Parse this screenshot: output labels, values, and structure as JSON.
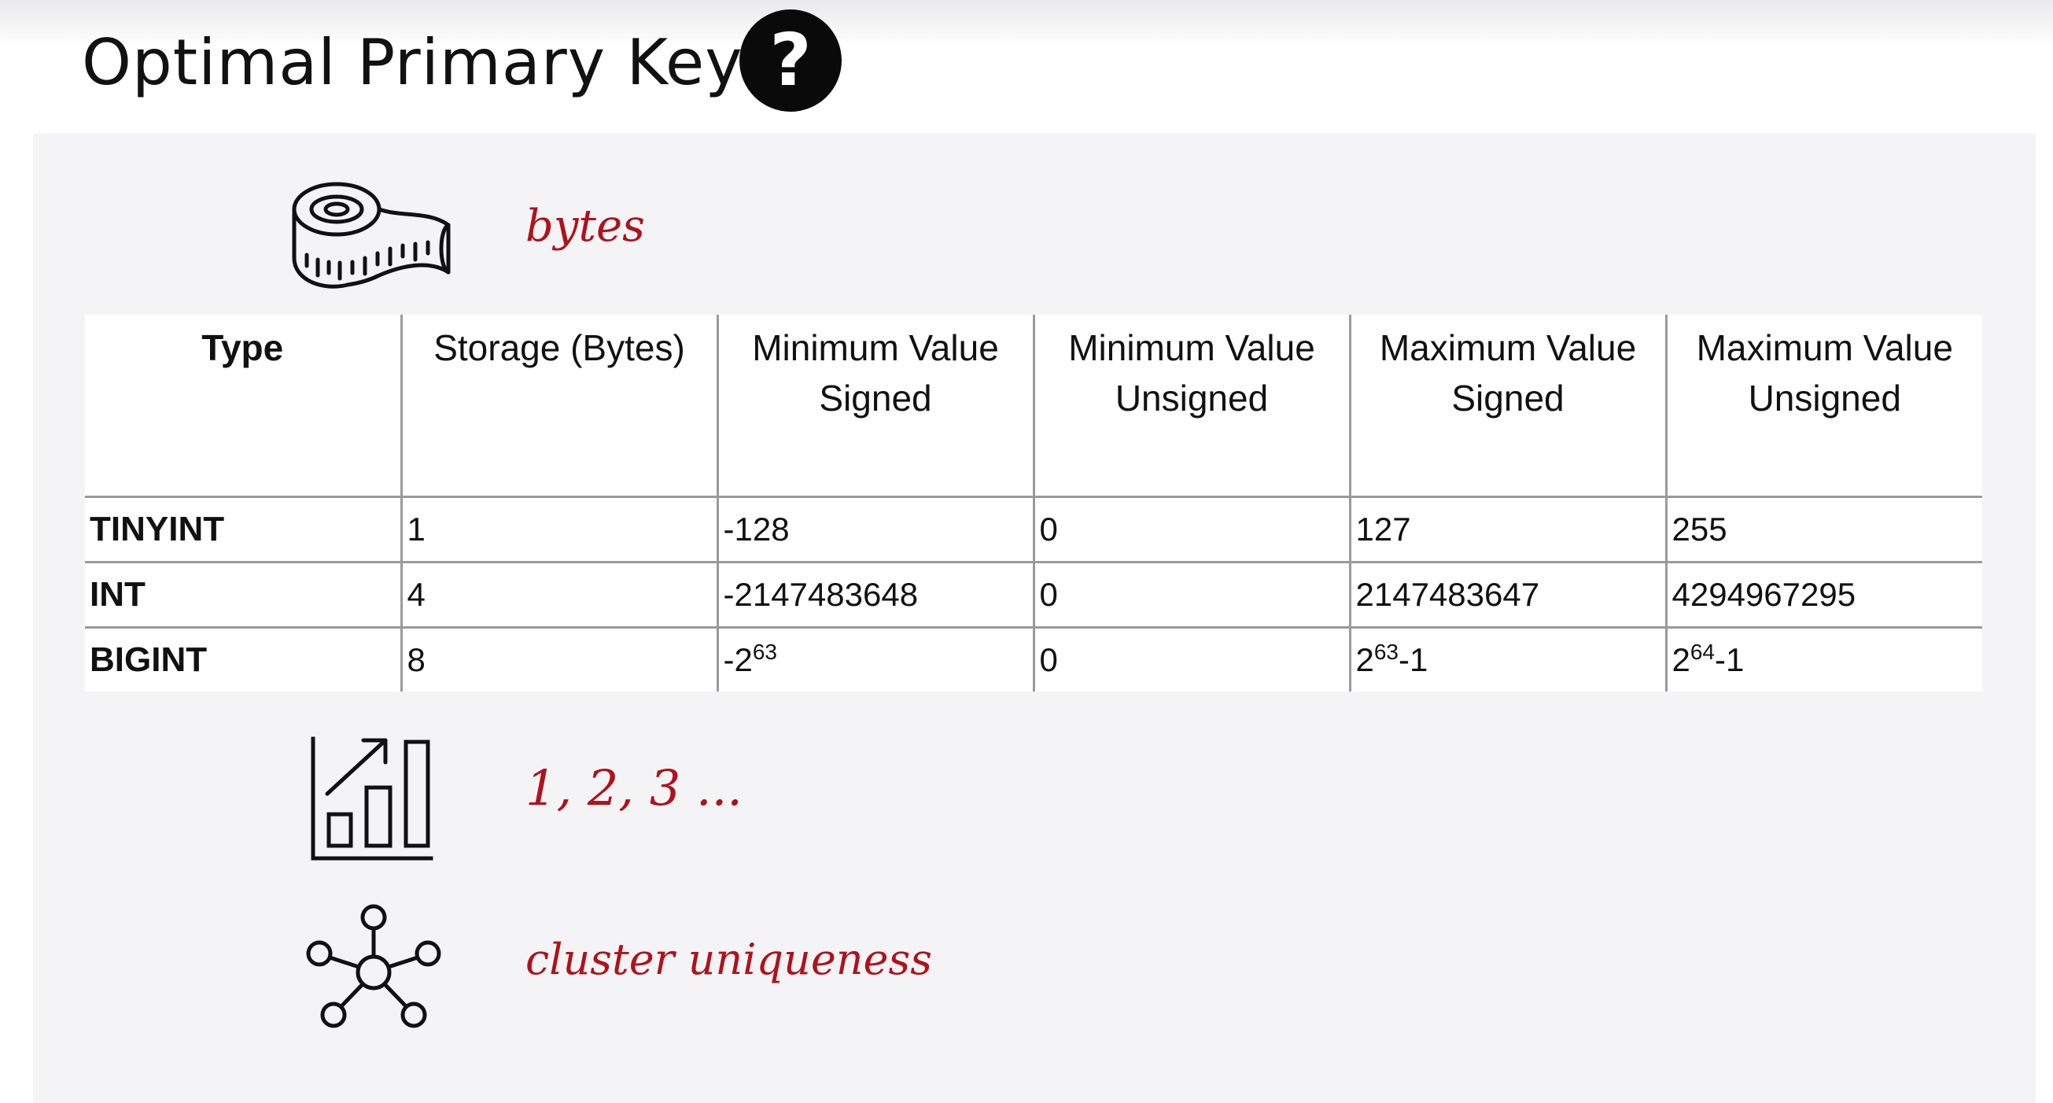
{
  "slide": {
    "title": "Optimal Primary Key",
    "help_glyph": "?",
    "help_icon": "question-circle-icon"
  },
  "annotations": {
    "bytes": "bytes",
    "sequence": "1, 2, 3 ...",
    "cluster": "cluster uniqueness"
  },
  "icons": {
    "tape": "measuring-tape-icon",
    "chart": "growth-chart-icon",
    "network": "network-hub-icon"
  },
  "colors": {
    "annotation": "#b0121c",
    "panel": "#f4f4f6",
    "badge": "#0a0a0a"
  },
  "table": {
    "headers": [
      {
        "line1": "Type",
        "line2": ""
      },
      {
        "line1": "Storage (Bytes)",
        "line2": ""
      },
      {
        "line1": "Minimum Value",
        "line2": "Signed"
      },
      {
        "line1": "Minimum Value",
        "line2": "Unsigned"
      },
      {
        "line1": "Maximum Value",
        "line2": "Signed"
      },
      {
        "line1": "Maximum Value",
        "line2": "Unsigned"
      }
    ],
    "rows": [
      {
        "type": "TINYINT",
        "storage": "1",
        "min_signed": {
          "base": "-128",
          "exp": "",
          "suffix": ""
        },
        "min_unsigned": "0",
        "max_signed": {
          "base": "127",
          "exp": "",
          "suffix": ""
        },
        "max_unsigned": {
          "base": "255",
          "exp": "",
          "suffix": ""
        }
      },
      {
        "type": "INT",
        "storage": "4",
        "min_signed": {
          "base": "-2147483648",
          "exp": "",
          "suffix": ""
        },
        "min_unsigned": "0",
        "max_signed": {
          "base": "2147483647",
          "exp": "",
          "suffix": ""
        },
        "max_unsigned": {
          "base": "4294967295",
          "exp": "",
          "suffix": ""
        }
      },
      {
        "type": "BIGINT",
        "storage": "8",
        "min_signed": {
          "base": "-2",
          "exp": "63",
          "suffix": ""
        },
        "min_unsigned": "0",
        "max_signed": {
          "base": "2",
          "exp": "63",
          "suffix": "-1"
        },
        "max_unsigned": {
          "base": "2",
          "exp": "64",
          "suffix": "-1"
        }
      }
    ]
  }
}
